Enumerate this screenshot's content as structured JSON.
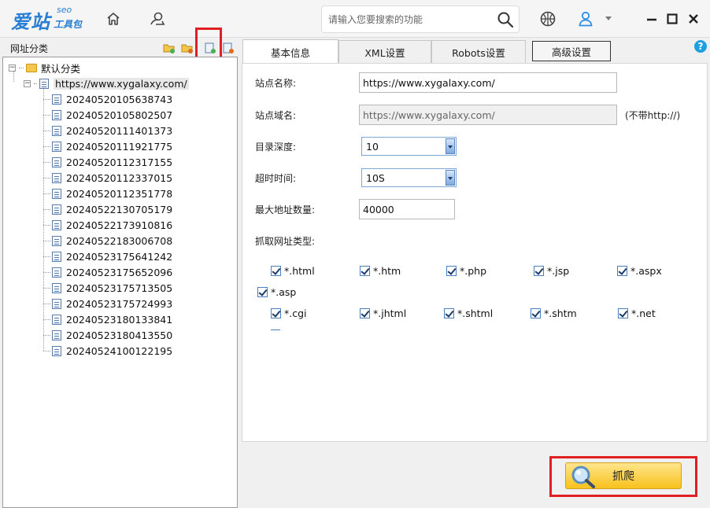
{
  "app": {
    "logo_main": "爱站",
    "logo_seo": "seo",
    "logo_sub": "工具包"
  },
  "search": {
    "placeholder": "请输入您要搜索的功能"
  },
  "sidebar": {
    "title": "网址分类",
    "root_label": "默认分类",
    "site_label": "https://www.xygalaxy.com/",
    "items": [
      "20240520105638743",
      "20240520105802507",
      "20240520111401373",
      "20240520111921775",
      "20240520112317155",
      "20240520112337015",
      "20240520112351778",
      "20240522130705179",
      "20240522173910816",
      "20240522183006708",
      "20240523175641242",
      "20240523175652096",
      "20240523175713505",
      "20240523175724993",
      "20240523180133841",
      "20240523180413550",
      "20240524100122195"
    ]
  },
  "tabs": [
    "基本信息",
    "XML设置",
    "Robots设置",
    "高级设置"
  ],
  "form": {
    "site_name_label": "站点名称:",
    "site_name_value": "https://www.xygalaxy.com/",
    "site_domain_label": "站点域名:",
    "site_domain_value": "https://www.xygalaxy.com/",
    "domain_hint": "(不带http://)",
    "depth_label": "目录深度:",
    "depth_value": "10",
    "timeout_label": "超时时间:",
    "timeout_value": "10S",
    "max_urls_label": "最大地址数量:",
    "max_urls_value": "40000",
    "types_label": "抓取网址类型:",
    "types": [
      "*.html",
      "*.htm",
      "*.php",
      "*.jsp",
      "*.aspx",
      "*.asp",
      "*.cgi",
      "*.jhtml",
      "*.shtml",
      "*.shtm",
      "*.net"
    ]
  },
  "crawl_button": "抓爬",
  "help": "?"
}
